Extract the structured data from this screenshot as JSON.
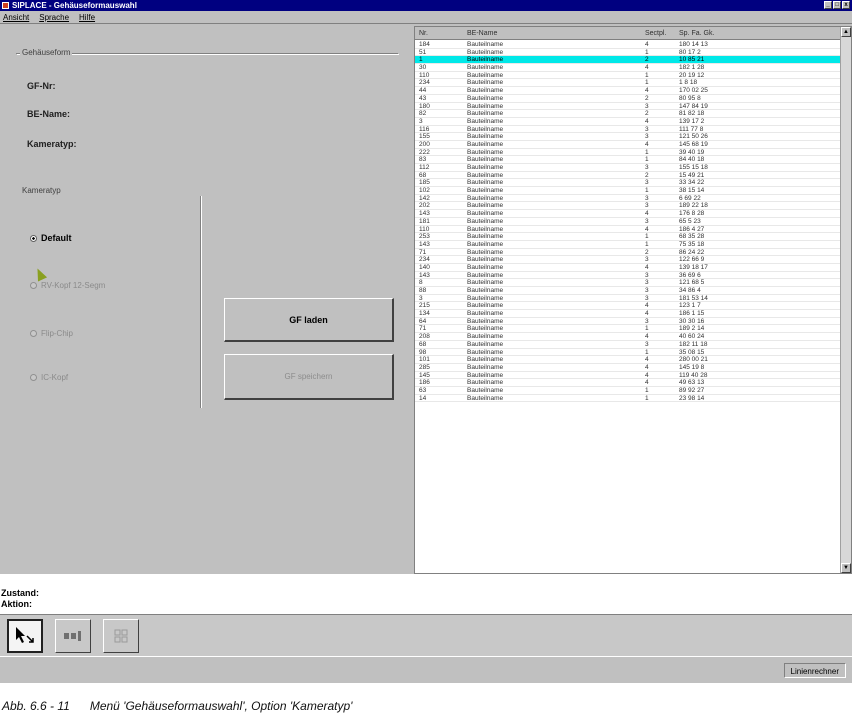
{
  "window": {
    "title": "SIPLACE - Gehäuseformauswahl",
    "controls": [
      "_",
      "□",
      "x"
    ]
  },
  "menu": {
    "items": [
      "Ansicht",
      "Sprache",
      "Hilfe"
    ]
  },
  "left": {
    "group_gehaeuseform": "Gehäuseform",
    "gf_nr_label": "GF-Nr:",
    "be_name_label": "BE-Name:",
    "kameratyp_label": "Kameratyp:",
    "group_kameratyp": "Kameratyp",
    "radios": [
      {
        "label": "Default",
        "state": "checked"
      },
      {
        "label": "RV-Kopf 12-Segm",
        "state": "disabled"
      },
      {
        "label": "Flip-Chip",
        "state": "disabled"
      },
      {
        "label": "IC-Kopf",
        "state": "disabled"
      }
    ],
    "btn_load": "GF laden",
    "btn_save": "GF speichern"
  },
  "list": {
    "headers": {
      "nr": "Nr.",
      "name": "BE-Name",
      "sect": "Sectpl.",
      "sp": "Sp. Fa. Gk."
    },
    "selected_index": 2,
    "rows": [
      [
        "184",
        "Bauteilname",
        "4",
        "180 14 13"
      ],
      [
        "51",
        "Bauteilname",
        "1",
        "80 17 2"
      ],
      [
        "1",
        "Bauteilname",
        "2",
        "10 85 21"
      ],
      [
        "30",
        "Bauteilname",
        "4",
        "182 1 28"
      ],
      [
        "110",
        "Bauteilname",
        "1",
        "20 19 12"
      ],
      [
        "234",
        "Bauteilname",
        "1",
        "1 8 18"
      ],
      [
        "44",
        "Bauteilname",
        "4",
        "170 02 25"
      ],
      [
        "43",
        "Bauteilname",
        "2",
        "80 95 8"
      ],
      [
        "180",
        "Bauteilname",
        "3",
        "147 84 19"
      ],
      [
        "82",
        "Bauteilname",
        "2",
        "81 82 18"
      ],
      [
        "3",
        "Bauteilname",
        "4",
        "139 17 2"
      ],
      [
        "116",
        "Bauteilname",
        "3",
        "111 77 8"
      ],
      [
        "155",
        "Bauteilname",
        "3",
        "121 50 26"
      ],
      [
        "200",
        "Bauteilname",
        "4",
        "145 68 19"
      ],
      [
        "222",
        "Bauteilname",
        "1",
        "39 40 19"
      ],
      [
        "83",
        "Bauteilname",
        "1",
        "84 40 18"
      ],
      [
        "112",
        "Bauteilname",
        "3",
        "155 15 18"
      ],
      [
        "68",
        "Bauteilname",
        "2",
        "15 49 21"
      ],
      [
        "185",
        "Bauteilname",
        "3",
        "33 34 22"
      ],
      [
        "102",
        "Bauteilname",
        "1",
        "38 15 14"
      ],
      [
        "142",
        "Bauteilname",
        "3",
        "6 69 22"
      ],
      [
        "202",
        "Bauteilname",
        "3",
        "189 22 18"
      ],
      [
        "143",
        "Bauteilname",
        "4",
        "176 8 28"
      ],
      [
        "181",
        "Bauteilname",
        "3",
        "65 5 23"
      ],
      [
        "110",
        "Bauteilname",
        "4",
        "186 4 27"
      ],
      [
        "253",
        "Bauteilname",
        "1",
        "68 35 28"
      ],
      [
        "143",
        "Bauteilname",
        "1",
        "75 35 18"
      ],
      [
        "71",
        "Bauteilname",
        "2",
        "86 24 22"
      ],
      [
        "234",
        "Bauteilname",
        "3",
        "122 66 9"
      ],
      [
        "140",
        "Bauteilname",
        "4",
        "139 18 17"
      ],
      [
        "143",
        "Bauteilname",
        "3",
        "36 69 6"
      ],
      [
        "8",
        "Bauteilname",
        "3",
        "121 68 5"
      ],
      [
        "88",
        "Bauteilname",
        "3",
        "34 86 4"
      ],
      [
        "3",
        "Bauteilname",
        "3",
        "181 53 14"
      ],
      [
        "215",
        "Bauteilname",
        "4",
        "123 1 7"
      ],
      [
        "134",
        "Bauteilname",
        "4",
        "186 1 15"
      ],
      [
        "64",
        "Bauteilname",
        "3",
        "30 30 16"
      ],
      [
        "71",
        "Bauteilname",
        "1",
        "189 2 14"
      ],
      [
        "208",
        "Bauteilname",
        "4",
        "40 60 24"
      ],
      [
        "68",
        "Bauteilname",
        "3",
        "182 11 18"
      ],
      [
        "98",
        "Bauteilname",
        "1",
        "35 08 15"
      ],
      [
        "101",
        "Bauteilname",
        "4",
        "280 00 21"
      ],
      [
        "285",
        "Bauteilname",
        "4",
        "145 19 8"
      ],
      [
        "145",
        "Bauteilname",
        "4",
        "119 40 28"
      ],
      [
        "186",
        "Bauteilname",
        "4",
        "49 63 13"
      ],
      [
        "63",
        "Bauteilname",
        "1",
        "89 92 27"
      ],
      [
        "14",
        "Bauteilname",
        "1",
        "23 98 14"
      ]
    ]
  },
  "status": {
    "zustand": "Zustand:",
    "aktion": "Aktion:"
  },
  "toolbar": {
    "tools": [
      "pointer-tool-icon",
      "layout-bars-icon",
      "grid-icon"
    ]
  },
  "statusbar": {
    "right": "Linienrechner"
  },
  "caption": "Abb. 6.6 - 11      Menü 'Gehäuseformauswahl', Option 'Kameratyp'"
}
